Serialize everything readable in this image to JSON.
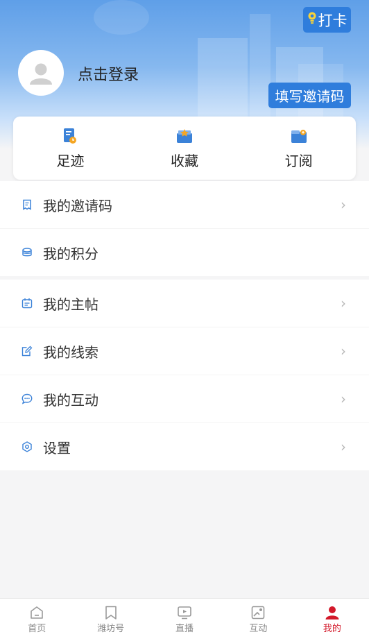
{
  "header": {
    "checkin_label": "打卡",
    "login_label": "点击登录",
    "invite_button_label": "填写邀请码"
  },
  "quick": [
    {
      "label": "足迹",
      "icon": "footprint-icon"
    },
    {
      "label": "收藏",
      "icon": "favorites-icon"
    },
    {
      "label": "订阅",
      "icon": "subscribe-icon"
    }
  ],
  "menu_group1": [
    {
      "label": "我的邀请码",
      "icon": "invite-code-icon"
    },
    {
      "label": "我的积分",
      "icon": "points-icon"
    }
  ],
  "menu_group2": [
    {
      "label": "我的主帖",
      "icon": "posts-icon"
    },
    {
      "label": "我的线索",
      "icon": "clues-icon"
    },
    {
      "label": "我的互动",
      "icon": "interaction-icon"
    },
    {
      "label": "设置",
      "icon": "settings-icon"
    }
  ],
  "tabbar": [
    {
      "label": "首页"
    },
    {
      "label": "潍坊号"
    },
    {
      "label": "直播"
    },
    {
      "label": "互动"
    },
    {
      "label": "我的"
    }
  ],
  "colors": {
    "accent": "#2f7ddc",
    "active_tab": "#d3192a",
    "icon_blue": "#3b82d8"
  }
}
